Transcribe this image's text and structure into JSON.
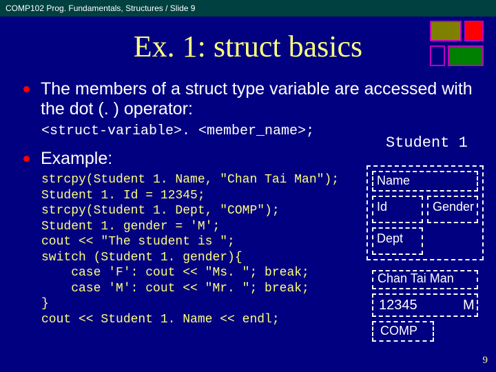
{
  "header": "COMP102 Prog. Fundamentals, Structures / Slide 9",
  "title": "Ex. 1:  struct basics",
  "bullet1_a": "The members of a ",
  "bullet1_b": "struct",
  "bullet1_c": " type variable are accessed with the dot (. ) operator:",
  "syntax": "<struct-variable>. <member_name>;",
  "bullet2": "Example:",
  "code": "strcpy(Student 1. Name, \"Chan Tai Man\");\nStudent 1. Id = 12345;\nstrcpy(Student 1. Dept, \"COMP\");\nStudent 1. gender = 'M';\ncout << \"The student is \";\nswitch (Student 1. gender){\n    case 'F': cout << \"Ms. \"; break;\n    case 'M': cout << \"Mr. \"; break;\n}\ncout << Student 1. Name << endl;",
  "diagram": {
    "varname": "Student 1",
    "labels": {
      "name": "Name",
      "id": "Id",
      "gender": "Gender",
      "dept": "Dept"
    },
    "values": {
      "name": "Chan Tai Man",
      "id": "12345",
      "gender": "M",
      "dept": "COMP"
    }
  },
  "pagenum": "9"
}
